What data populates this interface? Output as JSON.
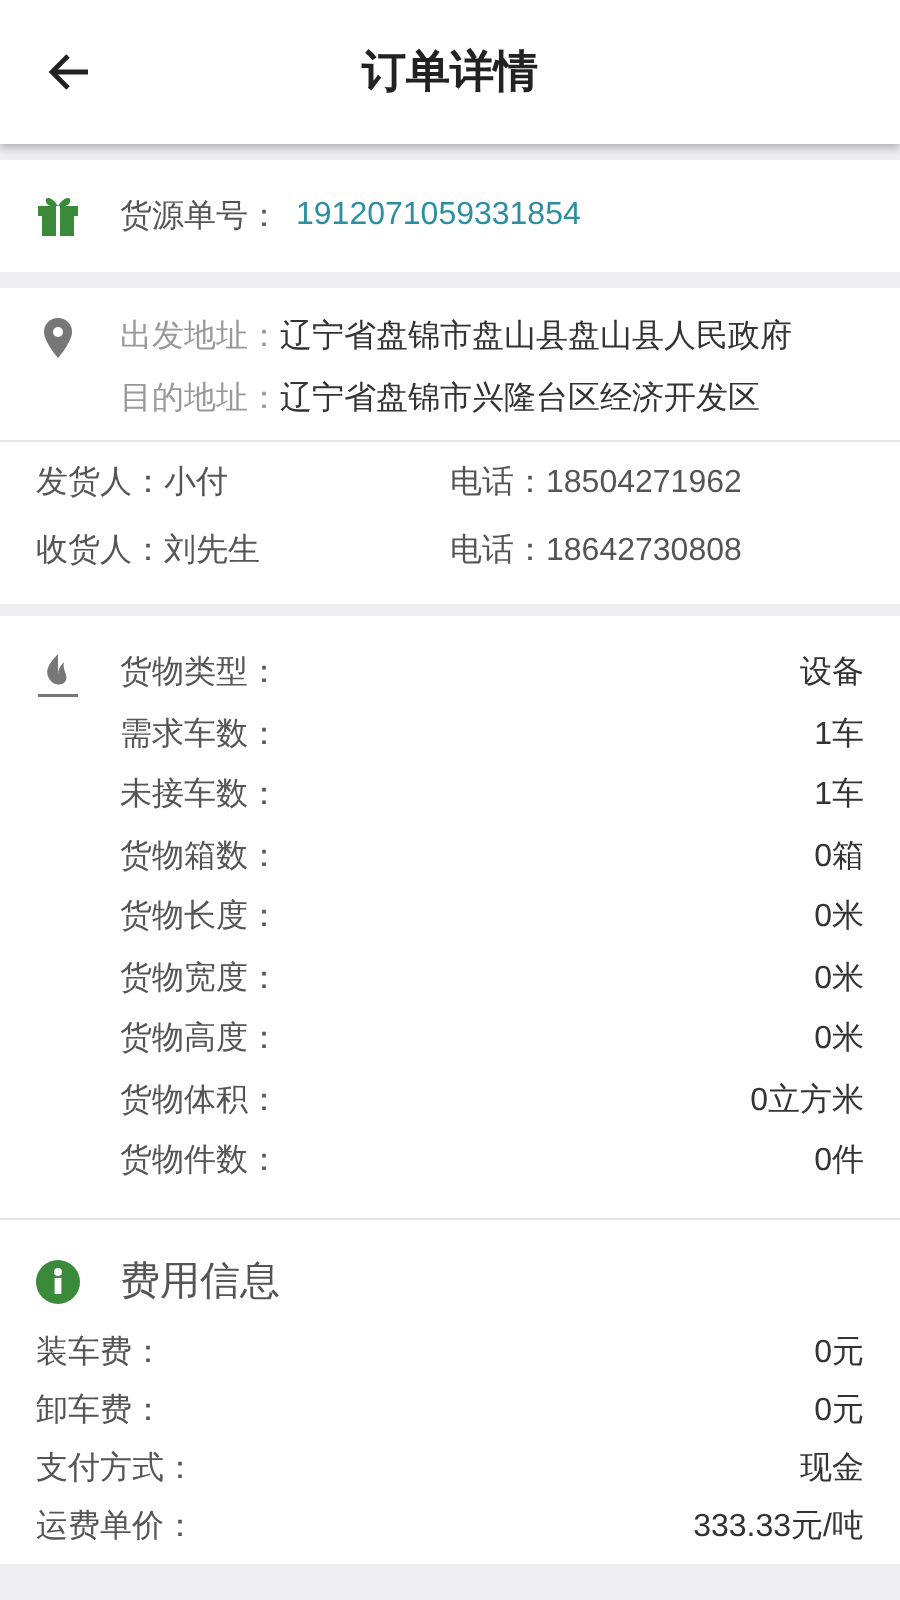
{
  "header": {
    "title": "订单详情"
  },
  "order": {
    "label": "货源单号：",
    "number": "1912071059331854"
  },
  "addresses": [
    {
      "label": "出发地址：",
      "value": "辽宁省盘锦市盘山县盘山县人民政府"
    },
    {
      "label": "目的地址：",
      "value": "辽宁省盘锦市兴隆台区经济开发区"
    }
  ],
  "contacts": [
    {
      "label": "发货人：",
      "name": "小付",
      "phone_label": "电话：",
      "phone": "18504271962"
    },
    {
      "label": "收货人：",
      "name": "刘先生",
      "phone_label": "电话：",
      "phone": "18642730808"
    }
  ],
  "cargo": [
    {
      "label": "货物类型：",
      "value": "设备"
    },
    {
      "label": "需求车数：",
      "value": "1车"
    },
    {
      "label": "未接车数：",
      "value": "1车"
    },
    {
      "label": "货物箱数：",
      "value": "0箱"
    },
    {
      "label": "货物长度：",
      "value": "0米"
    },
    {
      "label": "货物宽度：",
      "value": "0米"
    },
    {
      "label": "货物高度：",
      "value": "0米"
    },
    {
      "label": "货物体积：",
      "value": "0立方米"
    },
    {
      "label": "货物件数：",
      "value": "0件"
    }
  ],
  "fees": {
    "title": "费用信息",
    "rows": [
      {
        "label": "装车费：",
        "value": "0元"
      },
      {
        "label": "卸车费：",
        "value": "0元"
      },
      {
        "label": "支付方式：",
        "value": "现金"
      },
      {
        "label": "运费单价：",
        "value": "333.33元/吨"
      }
    ]
  }
}
